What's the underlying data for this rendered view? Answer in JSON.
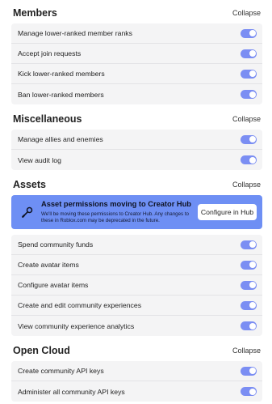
{
  "sections": {
    "members": {
      "title": "Members",
      "collapse_label": "Collapse",
      "items": [
        {
          "label": "Manage lower-ranked member ranks",
          "enabled": true
        },
        {
          "label": "Accept join requests",
          "enabled": true
        },
        {
          "label": "Kick lower-ranked members",
          "enabled": true
        },
        {
          "label": "Ban lower-ranked members",
          "enabled": true
        }
      ]
    },
    "misc": {
      "title": "Miscellaneous",
      "collapse_label": "Collapse",
      "items": [
        {
          "label": "Manage allies and enemies",
          "enabled": true
        },
        {
          "label": "View audit log",
          "enabled": true
        }
      ]
    },
    "assets": {
      "title": "Assets",
      "collapse_label": "Collapse",
      "banner": {
        "title": "Asset permissions moving to Creator Hub",
        "text": "We'll be moving these permissions to Creator Hub. Any changes to these in Roblox.com may be deprecated in the future.",
        "button_label": "Configure in Hub",
        "icon": "brush-icon"
      },
      "items": [
        {
          "label": "Spend community funds",
          "enabled": true
        },
        {
          "label": "Create avatar items",
          "enabled": true
        },
        {
          "label": "Configure avatar items",
          "enabled": true
        },
        {
          "label": "Create and edit community experiences",
          "enabled": true
        },
        {
          "label": "View community experience analytics",
          "enabled": true
        }
      ]
    },
    "open_cloud": {
      "title": "Open Cloud",
      "collapse_label": "Collapse",
      "items": [
        {
          "label": "Create community API keys",
          "enabled": true
        },
        {
          "label": "Administer all community API keys",
          "enabled": true
        }
      ]
    }
  },
  "colors": {
    "toggle_on": "#7b8ef3",
    "banner_bg": "#6e8ff4",
    "panel_bg": "#f4f4f5"
  }
}
